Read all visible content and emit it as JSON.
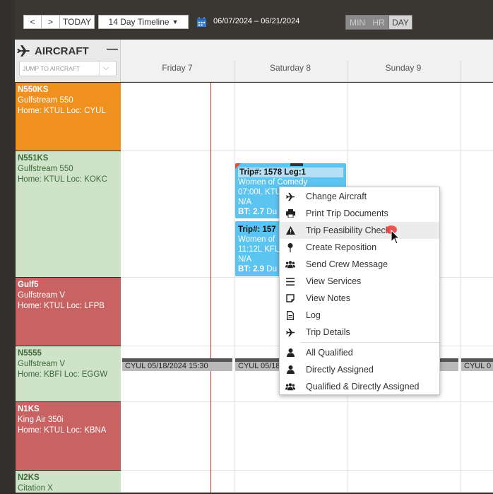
{
  "toolbar": {
    "prev": "<",
    "next": ">",
    "today": "TODAY",
    "view_select": "14 Day Timeline",
    "date_range": "06/07/2024 – 06/21/2024",
    "zoom": [
      "MIN",
      "HR",
      "DAY"
    ],
    "zoom_active": "DAY"
  },
  "sidebar": {
    "title": "AIRCRAFT",
    "collapse": "—",
    "jump_placeholder": "JUMP TO AIRCRAFT"
  },
  "days": [
    "Friday 7",
    "Saturday 8",
    "Sunday 9"
  ],
  "aircraft": [
    {
      "reg": "N550KS",
      "type": "Gulfstream 550",
      "home": "Home: KTUL Loc: CYUL",
      "color": "#f0901e"
    },
    {
      "reg": "N551KS",
      "type": "Gulfstream 550",
      "home": "Home: KTUL Loc: KOKC",
      "color": "#cfe3c9"
    },
    {
      "reg": "Gulf5",
      "type": "Gulfstream V",
      "home": "Home: KTUL Loc: LFPB",
      "color": "#c96262"
    },
    {
      "reg": "N5555",
      "type": "Gulfstream V",
      "home": "Home: KBFI Loc: EGGW",
      "color": "#cfe3c9"
    },
    {
      "reg": "N1KS",
      "type": "King Air 350i",
      "home": "Home: KTUL Loc: KBNA",
      "color": "#c96262"
    },
    {
      "reg": "N2KS",
      "type": "Citation X",
      "home": "",
      "color": "#cfe3c9"
    }
  ],
  "trips": [
    {
      "title": "Trip#: 1578 Leg:1",
      "line1": "Women of Comedy",
      "line2": "07:00L KTU",
      "line3": "N/A",
      "bt": "BT: 2.7",
      "extra": "Du"
    },
    {
      "title": "Trip#: 157",
      "line1": "Women of",
      "line2": "11:12L KFL",
      "line3": "N/A",
      "bt": "BT: 2.9",
      "extra": "Du"
    }
  ],
  "maintenance": [
    "CYUL 05/18/2024 15:30",
    "CYUL 05/18",
    "CYUL 0"
  ],
  "menu": {
    "items": [
      {
        "label": "Change Aircraft",
        "icon": "plane-icon"
      },
      {
        "label": "Print Trip Documents",
        "icon": "printer-icon"
      },
      {
        "label": "Trip Feasibility Check",
        "icon": "warning-icon"
      },
      {
        "label": "Create Reposition",
        "icon": "pin-icon"
      },
      {
        "label": "Send Crew Message",
        "icon": "users-icon"
      },
      {
        "label": "View Services",
        "icon": "list-icon"
      },
      {
        "label": "View Notes",
        "icon": "note-icon"
      },
      {
        "label": "Log",
        "icon": "document-icon"
      },
      {
        "label": "Trip Details",
        "icon": "plane-icon"
      }
    ],
    "crew_items": [
      {
        "label": "All Qualified",
        "icon": "user-icon"
      },
      {
        "label": "Directly Assigned",
        "icon": "user-icon"
      },
      {
        "label": "Qualified & Directly Assigned",
        "icon": "users-icon"
      }
    ]
  }
}
